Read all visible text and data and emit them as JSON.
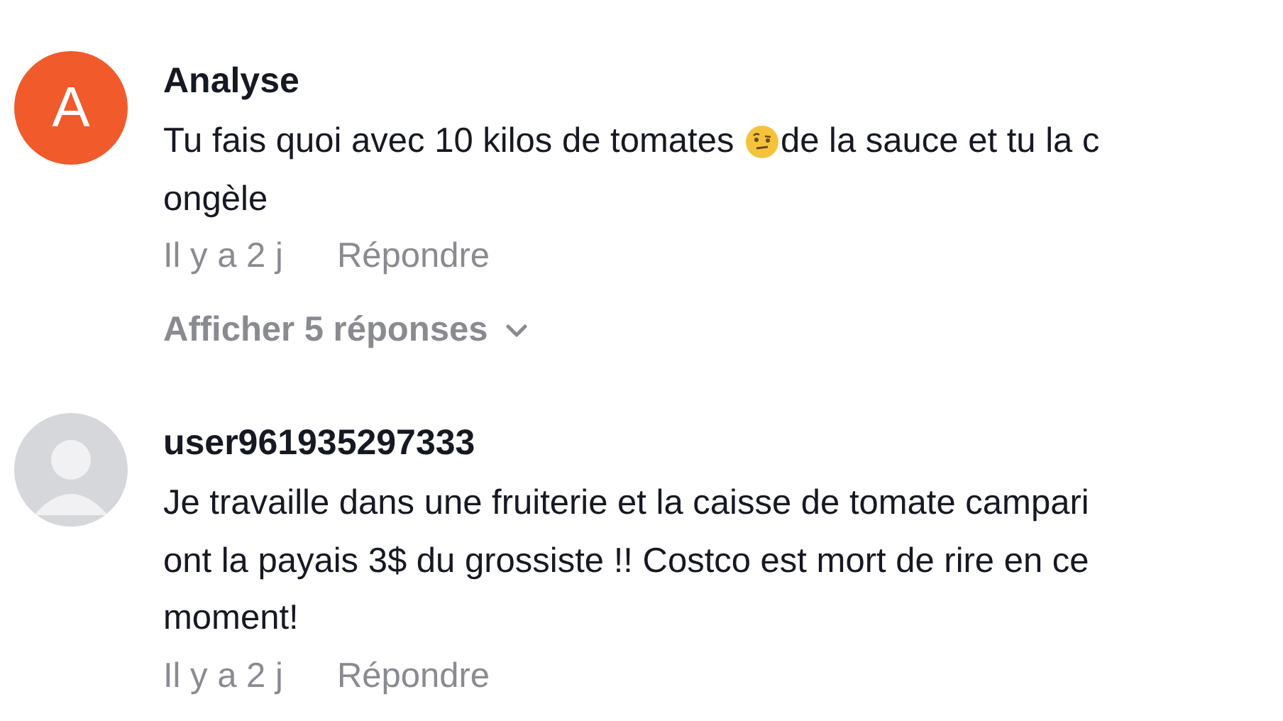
{
  "comments": [
    {
      "author": "Analyse",
      "avatar": {
        "kind": "letter",
        "letter": "A",
        "color": "#f15a2b"
      },
      "lines": [
        [
          {
            "kind": "text",
            "text": "Tu fais quoi avec 10 kilos de tomates "
          },
          {
            "kind": "emoji"
          },
          {
            "kind": "text",
            "text": "de la sauce et tu la c"
          }
        ],
        [
          {
            "kind": "text",
            "text": "ongèle"
          }
        ]
      ],
      "time": "Il y a 2 j",
      "reply": "Répondre",
      "show_replies": "Afficher 5 réponses"
    },
    {
      "author": "user961935297333",
      "avatar": {
        "kind": "default"
      },
      "lines": [
        [
          {
            "kind": "text",
            "text": "Je travaille dans une fruiterie et la caisse de tomate campari"
          }
        ],
        [
          {
            "kind": "text",
            "text": "ont la payais 3$ du grossiste !! Costco est mort de rire en ce"
          }
        ],
        [
          {
            "kind": "text",
            "text": "moment!"
          }
        ]
      ],
      "time": "Il y a 2 j",
      "reply": "Répondre"
    }
  ]
}
